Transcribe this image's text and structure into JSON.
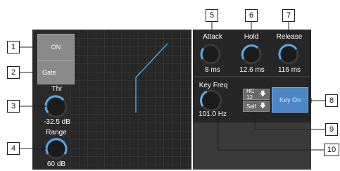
{
  "left": {
    "on_label": "ON",
    "gate_label": "Gate",
    "thr_label": "Thr",
    "thr_value": "-32.5 dB",
    "range_label": "Range",
    "range_value": "60 dB"
  },
  "dynamics": {
    "attack_label": "Attack",
    "attack_value": "8 ms",
    "hold_label": "Hold",
    "hold_value": "12.6 ms",
    "release_label": "Release",
    "release_value": "116 ms"
  },
  "key": {
    "freq_label": "Key Freq",
    "freq_value": "101.0 Hz",
    "filter_label": "HC 12",
    "source_label": "Self",
    "key_on_label": "Key On"
  },
  "callouts": [
    "1",
    "2",
    "3",
    "4",
    "5",
    "6",
    "7",
    "8",
    "9",
    "10"
  ],
  "colors": {
    "accent": "#4b87c6",
    "knob_arc": "#5aa7e8",
    "panel": "#2a2a2a"
  }
}
